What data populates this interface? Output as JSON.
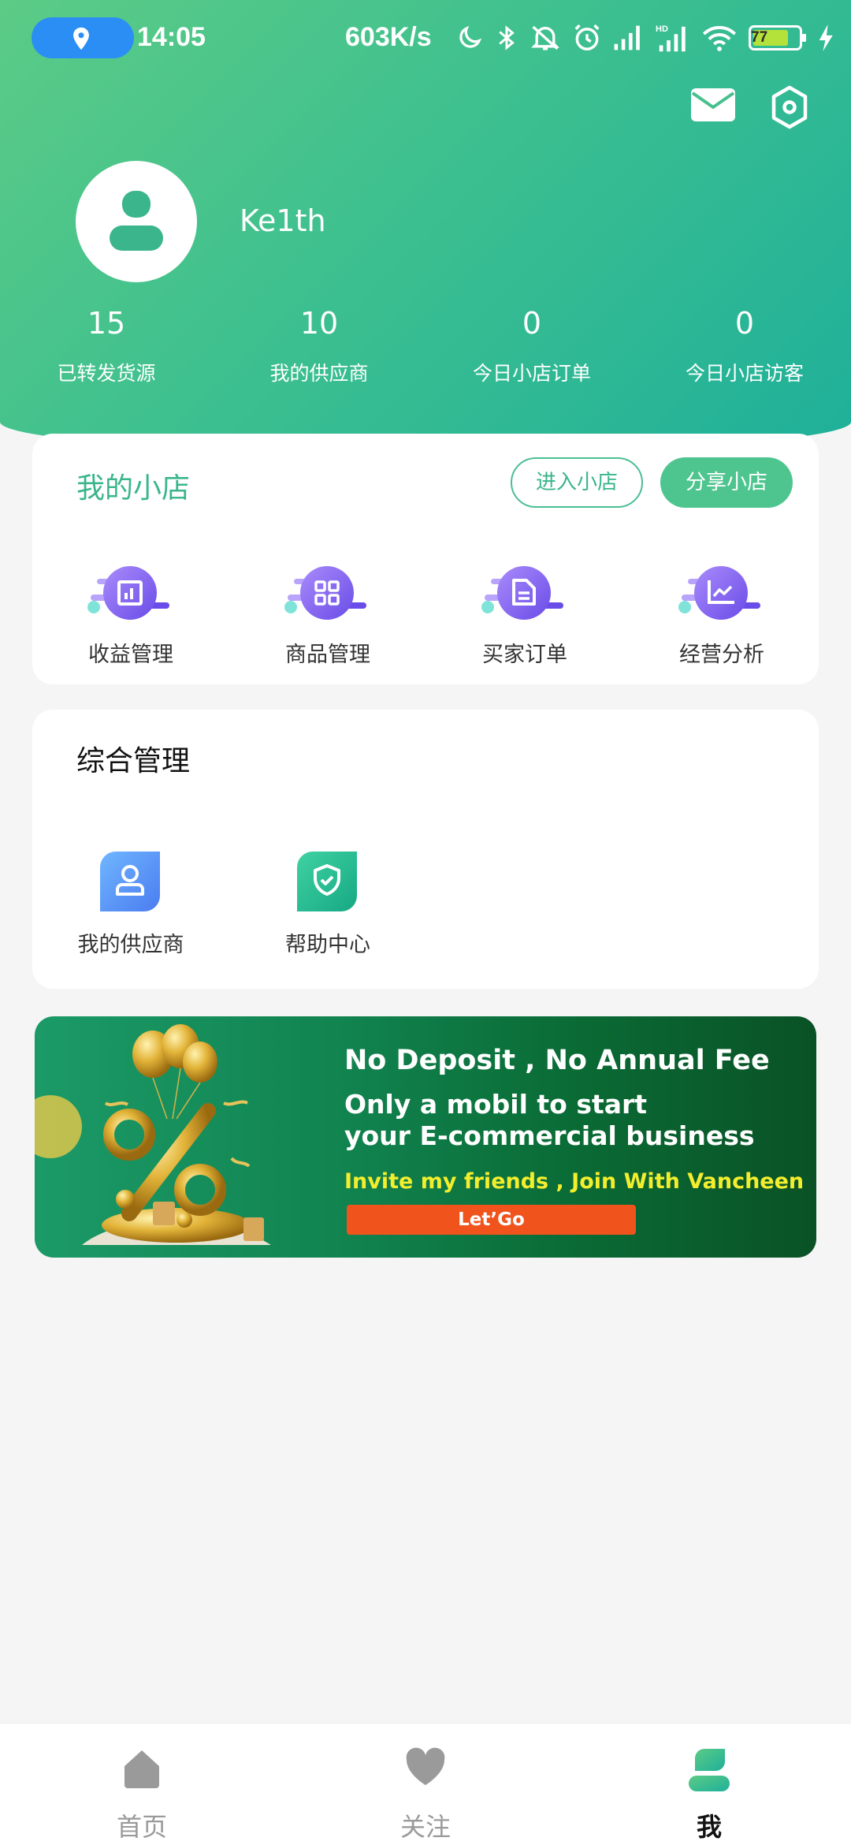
{
  "status_bar": {
    "time": "14:05",
    "net_speed": "603K/s",
    "battery": "77",
    "icons": [
      "location-icon",
      "moon-icon",
      "bluetooth-icon",
      "mute-icon",
      "alarm-icon",
      "signal-icon",
      "hd-signal-icon",
      "wifi-icon",
      "battery-icon",
      "charging-icon"
    ]
  },
  "header": {
    "icons": [
      "mail-icon",
      "settings-icon"
    ]
  },
  "profile": {
    "username": "Ke1th"
  },
  "stats": [
    {
      "value": "15",
      "label": "已转发货源"
    },
    {
      "value": "10",
      "label": "我的供应商"
    },
    {
      "value": "0",
      "label": "今日小店订单"
    },
    {
      "value": "0",
      "label": "今日小店访客"
    }
  ],
  "shop": {
    "title": "我的小店",
    "enter_label": "进入小店",
    "share_label": "分享小店",
    "items": [
      {
        "label": "收益管理",
        "icon": "revenue-icon"
      },
      {
        "label": "商品管理",
        "icon": "products-grid-icon"
      },
      {
        "label": "买家订单",
        "icon": "orders-doc-icon"
      },
      {
        "label": "经营分析",
        "icon": "analytics-chart-icon"
      }
    ]
  },
  "management": {
    "title": "综合管理",
    "items": [
      {
        "label": "我的供应商",
        "icon": "supplier-icon"
      },
      {
        "label": "帮助中心",
        "icon": "help-shield-icon"
      }
    ]
  },
  "banner": {
    "line1": "No Deposit , No Annual Fee",
    "line2": "Only a mobil to start",
    "line3": "your E-commercial business",
    "line4": "Invite my friends , Join With Vancheen",
    "cta": "Let’Go"
  },
  "tabbar": [
    {
      "label": "首页",
      "icon": "home-icon",
      "active": false
    },
    {
      "label": "关注",
      "icon": "heart-icon",
      "active": false
    },
    {
      "label": "我",
      "icon": "profile-icon",
      "active": true
    }
  ],
  "colors": {
    "brand_green": "#3ab58c",
    "gradient_start": "#5ccb86",
    "gradient_end": "#1fb09a",
    "icon_purple": "#7b5cf0",
    "banner_cta": "#f0531c",
    "banner_highlight": "#f3ee2d"
  }
}
